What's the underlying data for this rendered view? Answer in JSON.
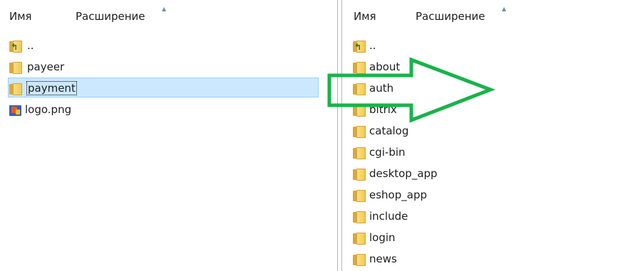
{
  "left_panel": {
    "columns": {
      "name": "Имя",
      "extension": "Расширение"
    },
    "items": [
      {
        "label": "..",
        "icon": "up-folder-icon"
      },
      {
        "label": "payeer",
        "icon": "folder-icon"
      },
      {
        "label": "payment",
        "icon": "folder-icon",
        "selected": true
      },
      {
        "label": "logo.png",
        "icon": "png-file-icon"
      }
    ]
  },
  "right_panel": {
    "columns": {
      "name": "Имя",
      "extension": "Расширение"
    },
    "items": [
      {
        "label": "..",
        "icon": "up-folder-icon"
      },
      {
        "label": "about",
        "icon": "folder-icon"
      },
      {
        "label": "auth",
        "icon": "folder-icon"
      },
      {
        "label": "bitrix",
        "icon": "folder-icon"
      },
      {
        "label": "catalog",
        "icon": "folder-icon"
      },
      {
        "label": "cgi-bin",
        "icon": "folder-icon"
      },
      {
        "label": "desktop_app",
        "icon": "folder-icon"
      },
      {
        "label": "eshop_app",
        "icon": "folder-icon"
      },
      {
        "label": "include",
        "icon": "folder-icon"
      },
      {
        "label": "login",
        "icon": "folder-icon"
      },
      {
        "label": "news",
        "icon": "folder-icon"
      }
    ]
  },
  "annotation": {
    "shape": "arrow-outline-right",
    "color": "#19b34a"
  },
  "colors": {
    "selection_bg": "#cce8ff",
    "selection_border": "#99d1ff",
    "folder": "#f2c64c"
  }
}
